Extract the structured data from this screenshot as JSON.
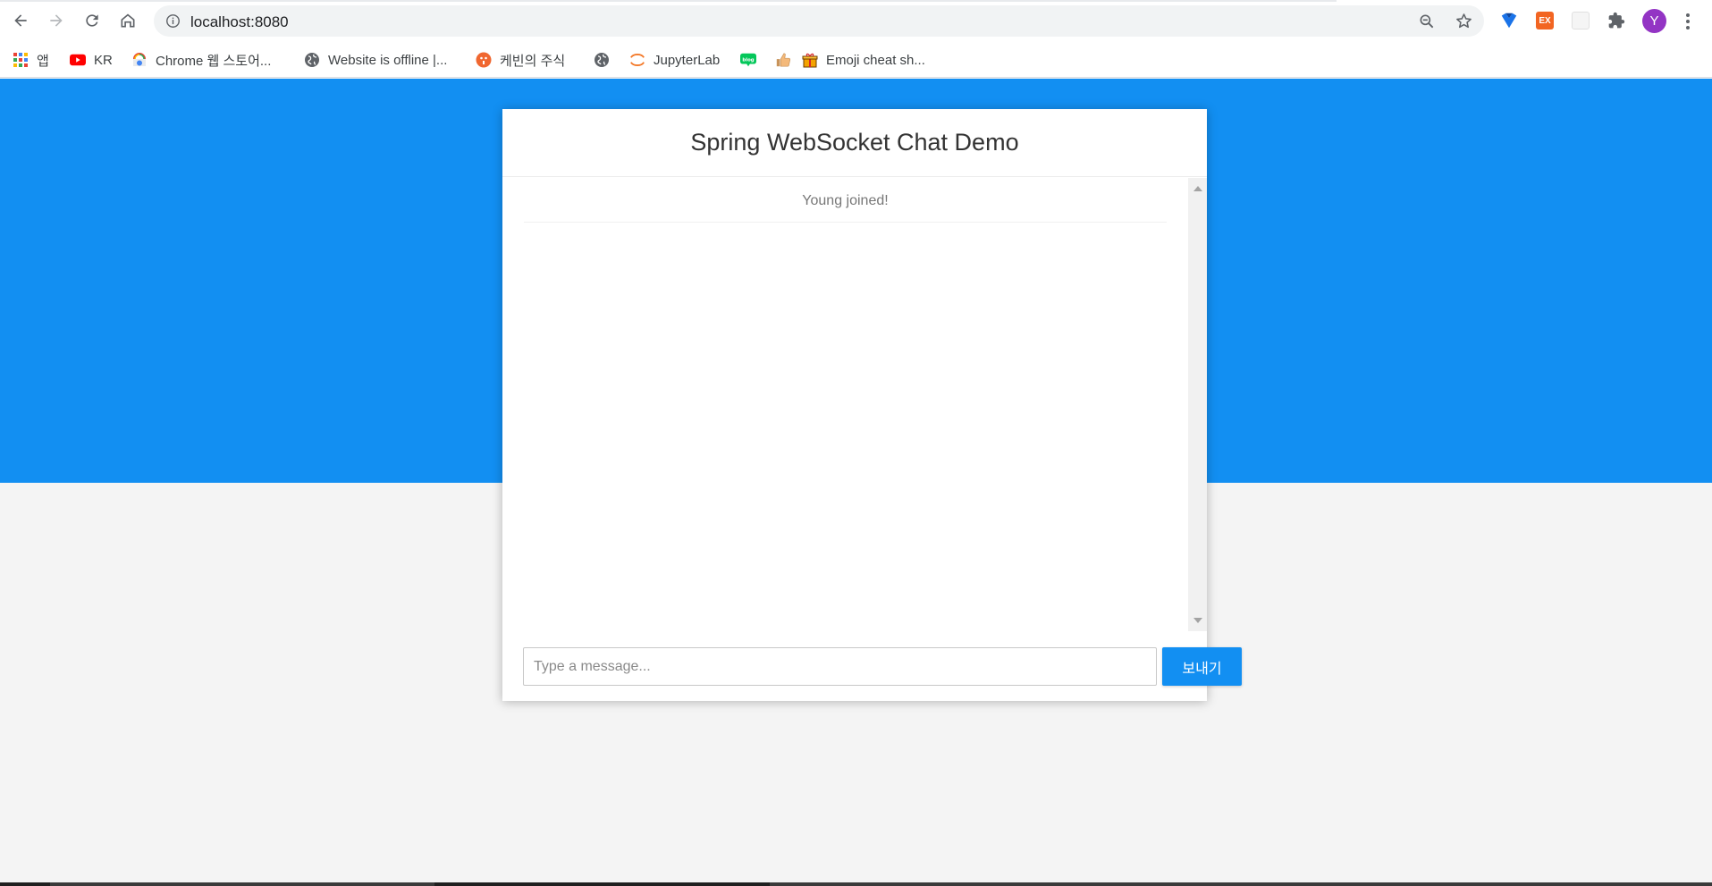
{
  "browser": {
    "url": "localhost:8080",
    "profile_initial": "Y",
    "ext_ex_label": "EX",
    "colors": {
      "avatar": "#9334c4",
      "ext_ex": "#f26522"
    }
  },
  "bookmarks": [
    {
      "icon": "apps-grid-icon",
      "label": "앱"
    },
    {
      "icon": "youtube-icon",
      "label": "KR"
    },
    {
      "icon": "chrome-webstore-icon",
      "label": "Chrome 웹 스토어..."
    },
    {
      "icon": "globe-icon",
      "label": "Website is offline |..."
    },
    {
      "icon": "kevin-stock-icon",
      "label": "케빈의 주식"
    },
    {
      "icon": "globe-icon",
      "label": ""
    },
    {
      "icon": "jupyter-icon",
      "label": "JupyterLab"
    },
    {
      "icon": "naver-blog-icon",
      "label": ""
    },
    {
      "icon": "thumbs-up-icon",
      "label": ""
    },
    {
      "icon": "gift-icon",
      "label": "Emoji cheat sh..."
    }
  ],
  "chat": {
    "title": "Spring WebSocket Chat Demo",
    "messages": [
      {
        "type": "event",
        "text": "Young joined!"
      }
    ],
    "input_placeholder": "Type a message...",
    "send_label": "보내기",
    "colors": {
      "primary": "#128ff2",
      "background": "#f4f4f4"
    }
  }
}
